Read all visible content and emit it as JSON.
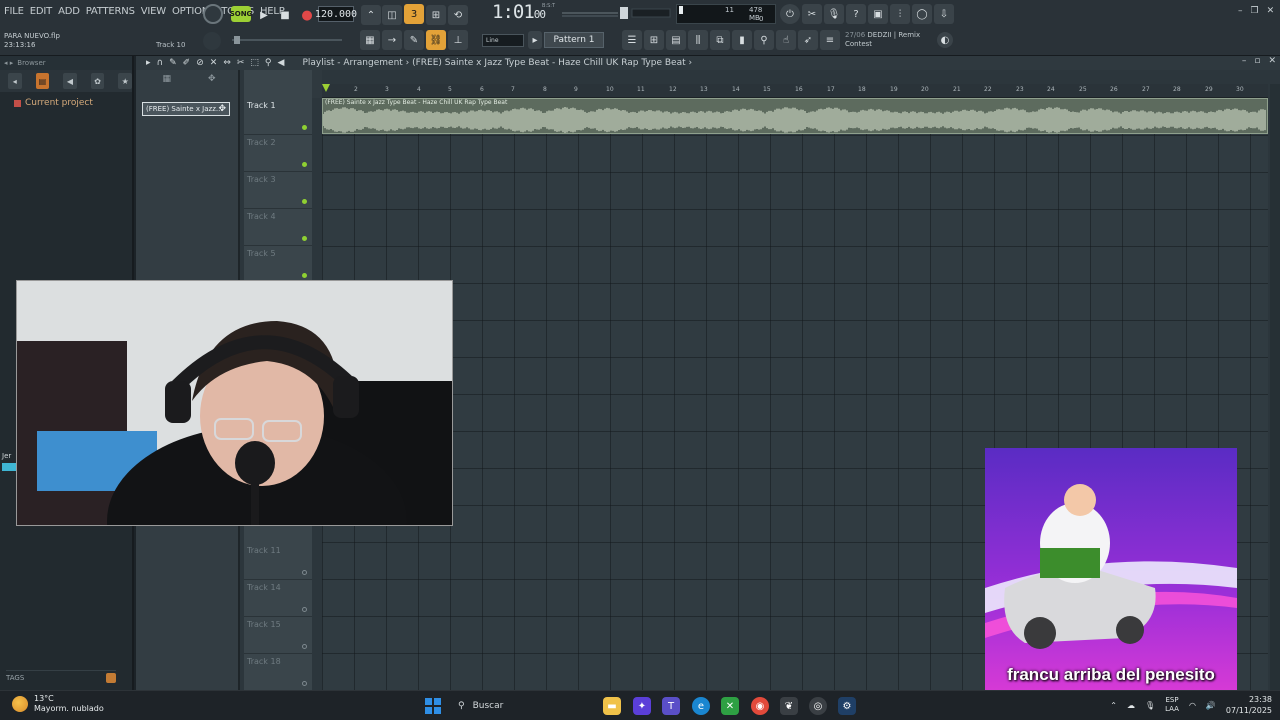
{
  "menu": [
    "FILE",
    "EDIT",
    "ADD",
    "PATTERNS",
    "VIEW",
    "OPTIONS",
    "TOOLS",
    "HELP"
  ],
  "transport": {
    "mode_label": "SONG",
    "tempo": "120.000",
    "time_main": "1:01",
    "time_sub": "00",
    "bpm_label": "B:S:T"
  },
  "cpu": {
    "voices": "11",
    "memory": "478 MB",
    "polyphony": "0"
  },
  "project": {
    "file": "PARA NUEVO.flp",
    "elapsed": "23:13:16",
    "track_hint": "Track 10"
  },
  "toolbar": {
    "snap": "Line",
    "pattern": "Pattern 1"
  },
  "news": {
    "date": "27/06",
    "line1": "DEDZII | Remix",
    "line2": "Contest"
  },
  "browser": {
    "title": "Browser",
    "item": "Current project",
    "tags_label": "TAGS"
  },
  "playlist": {
    "breadcrumb": "Playlist - Arrangement › (FREE) Sainte x Jazz Type Beat - Haze  Chill UK Rap Type Beat ›",
    "pattern_chip": "(FREE) Sainte x Jazz...",
    "clip_label": "(FREE) Sainte x Jazz Type Beat - Haze  Chill UK Rap Type Beat",
    "tracks_top": [
      "Track 1",
      "Track 2",
      "Track 3",
      "Track 4",
      "Track 5"
    ],
    "tracks_bottom": [
      "Track 11",
      "Track 14",
      "Track 15",
      "Track 18"
    ],
    "ruler_marks": [
      "2",
      "3",
      "4",
      "5",
      "6",
      "7",
      "8",
      "9",
      "10",
      "11",
      "12",
      "13",
      "14",
      "15",
      "16",
      "17",
      "18",
      "19",
      "20",
      "21",
      "22",
      "23",
      "24",
      "25",
      "26",
      "27",
      "28",
      "29",
      "30"
    ]
  },
  "overlay": {
    "side_tag": "Jer",
    "meme_caption": "francu arriba del penesito"
  },
  "taskbar": {
    "weather_temp": "13°C",
    "weather_desc": "Mayorm. nublado",
    "search_placeholder": "Buscar",
    "lang_top": "ESP",
    "lang_bottom": "LAA",
    "clock_time": "23:38",
    "clock_date": "07/11/2025"
  },
  "colors": {
    "accent": "#e3a238",
    "song": "#9ccf34",
    "clip": "#5d6b5e",
    "led": "#8fd032"
  }
}
